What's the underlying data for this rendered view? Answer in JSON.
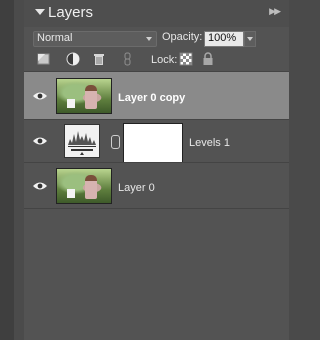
{
  "panel": {
    "title": "Layers",
    "menu_icon": "double-chevron-right-icon"
  },
  "controls": {
    "blend_mode": "Normal",
    "opacity_label": "Opacity:",
    "opacity_value": "100%",
    "lock_label": "Lock:"
  },
  "toolbar": {
    "icons": [
      "new-layer-icon",
      "adjustment-layer-icon",
      "trash-icon",
      "link-icon",
      "lock-transparency-icon",
      "lock-all-icon"
    ]
  },
  "layers": [
    {
      "name": "Layer 0 copy",
      "selected": true
    },
    {
      "name": "Levels 1",
      "selected": false
    },
    {
      "name": "Layer 0",
      "selected": false
    }
  ]
}
